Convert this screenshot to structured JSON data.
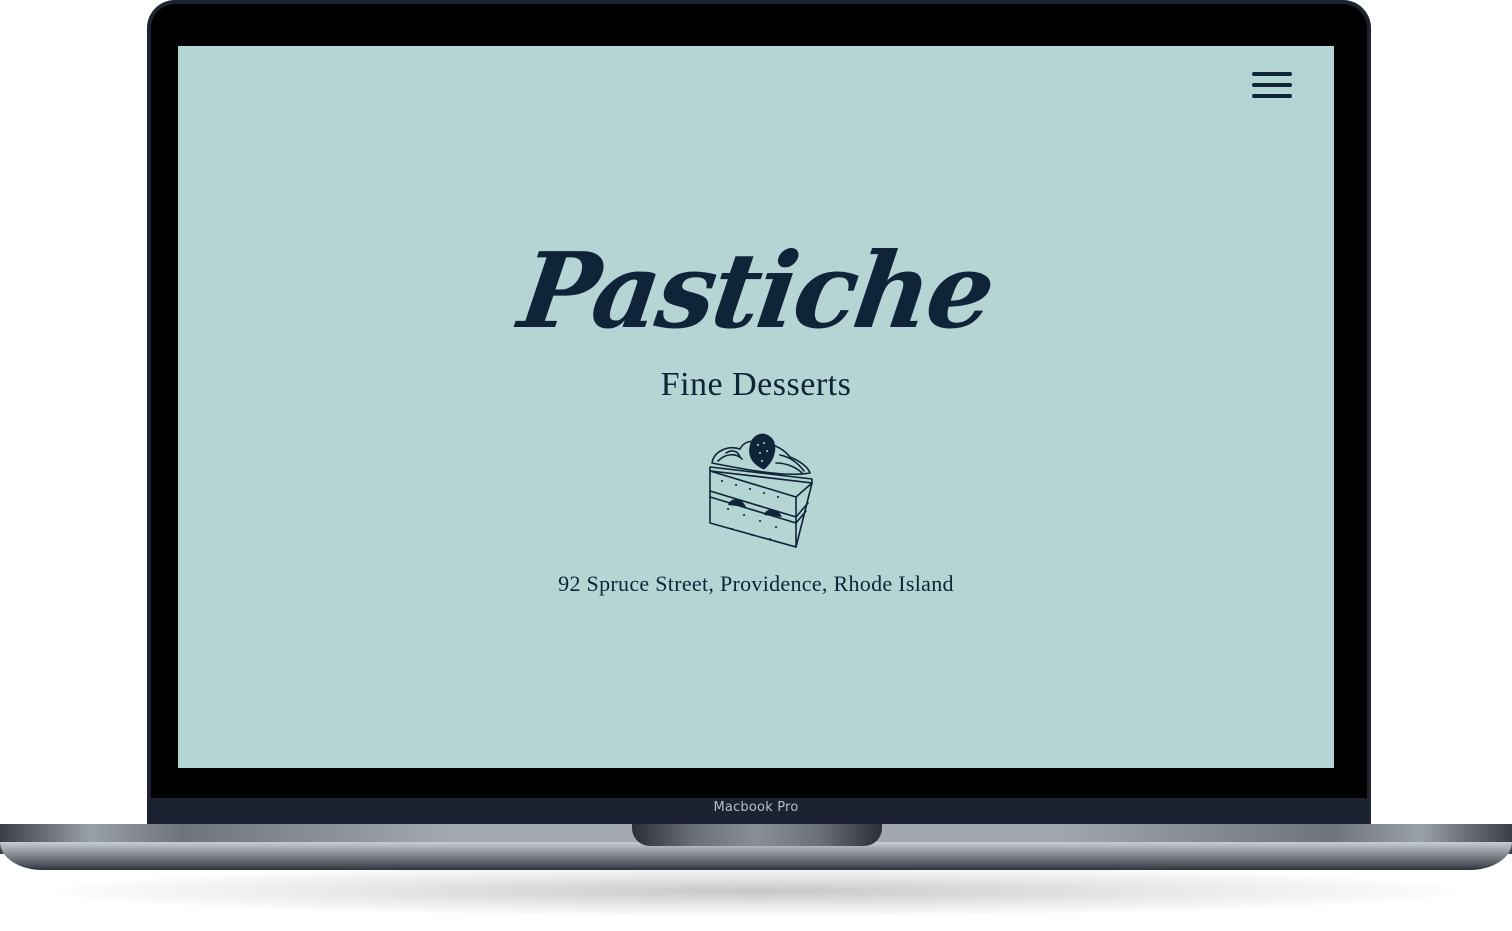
{
  "device": {
    "model_label": "Macbook Pro"
  },
  "site": {
    "brand": "Pastiche",
    "tagline": "Fine Desserts",
    "address": "92 Spruce Street, Providence, Rhode Island",
    "menu_icon": "hamburger-menu-icon",
    "hero_image": "cake-slice-illustration",
    "colors": {
      "background": "#b5d4d4",
      "ink": "#0f2438"
    }
  }
}
